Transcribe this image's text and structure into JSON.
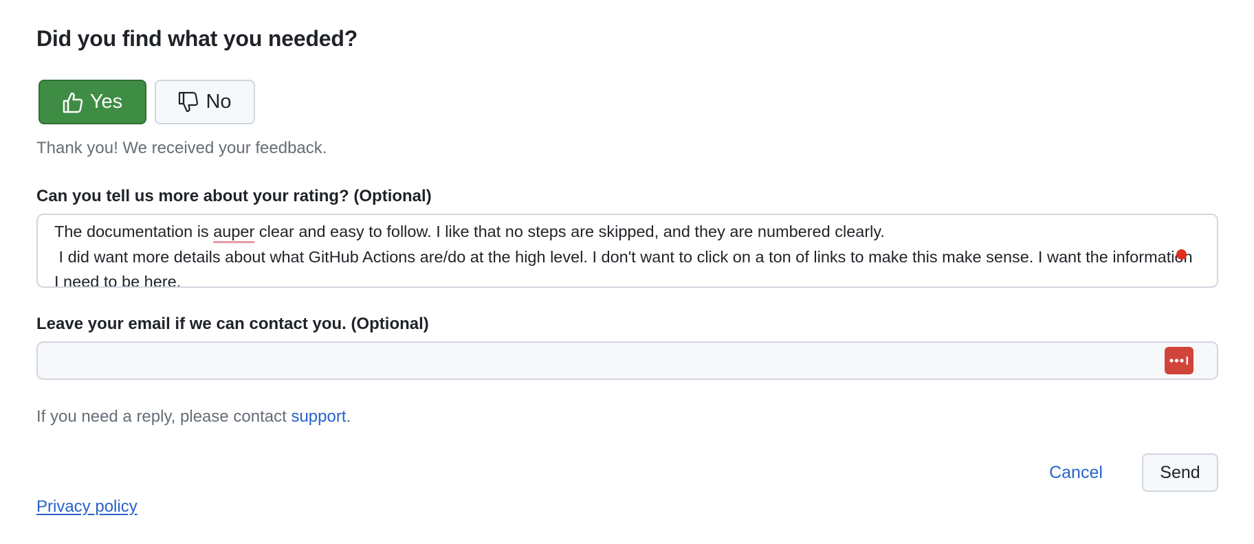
{
  "feedback": {
    "heading": "Did you find what you needed?",
    "yes_label": "Yes",
    "no_label": "No",
    "thanks_text": "Thank you! We received your feedback.",
    "rating_label": "Can you tell us more about your rating? (Optional)",
    "comment": {
      "line1_before": "The documentation is ",
      "misspelled_word": "auper",
      "line1_after": " clear and easy to follow. I like that no steps are skipped, and they are numbered clearly.",
      "rest": "\n I did want more details about what GitHub Actions are/do at the high level. I don't want to click on a ton of links to make this make sense. I want the information I need to be here."
    },
    "email_label": "Leave your email if we can contact you. (Optional)",
    "email_value": "",
    "reply_note_prefix": "If you need a reply, please contact ",
    "support_link": "support",
    "reply_note_suffix": ".",
    "cancel_label": "Cancel",
    "send_label": "Send",
    "privacy_label": "Privacy policy"
  },
  "icons": {
    "yes": "thumbs-up-icon",
    "no": "thumbs-down-icon",
    "password_manager": "password-manager-icon"
  },
  "colors": {
    "yes_button": "#3f8c44",
    "link": "#2862c9",
    "muted_text": "#656d76",
    "password_manager": "#d0443a"
  }
}
